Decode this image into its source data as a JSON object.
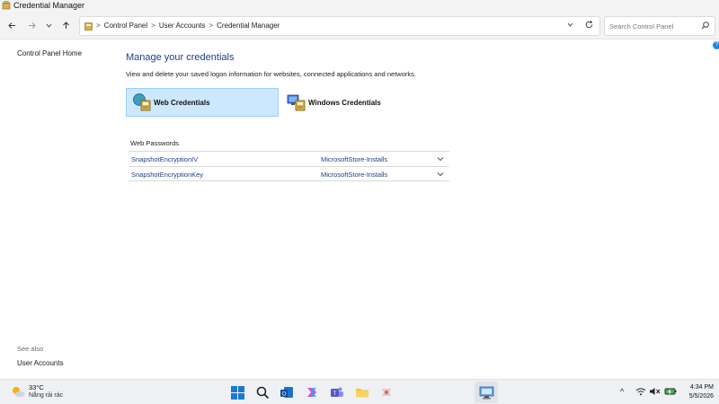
{
  "window": {
    "title": "Credential Manager"
  },
  "address_bar": {
    "breadcrumbs": [
      "Control Panel",
      "User Accounts",
      "Credential Manager"
    ],
    "separator": ">",
    "search_placeholder": "Search Control Panel"
  },
  "left_nav": {
    "home_link": "Control Panel Home",
    "see_also_label": "See also",
    "see_also_links": [
      "User Accounts"
    ]
  },
  "main": {
    "title": "Manage your credentials",
    "description": "View and delete your saved logon information for websites, connected applications and networks.",
    "tabs": [
      {
        "label": "Web Credentials",
        "selected": true
      },
      {
        "label": "Windows Credentials",
        "selected": false
      }
    ],
    "section_title": "Web Passwords",
    "credentials": [
      {
        "name": "SnapshotEncryptionIV",
        "source": "MicrosoftStore-Installs"
      },
      {
        "name": "SnapshotEncryptionKey",
        "source": "MicrosoftStore-Installs"
      }
    ]
  },
  "taskbar": {
    "weather_temp": "33°C",
    "weather_condition": "Nắng rải rác",
    "time": "4:34 PM",
    "date": "5/5/2026",
    "tray_chevron": "^"
  },
  "colors": {
    "link_blue": "#1e3e8a",
    "selected_tab_bg": "#cce8ff",
    "taskbar_bg": "#eef0f4"
  }
}
